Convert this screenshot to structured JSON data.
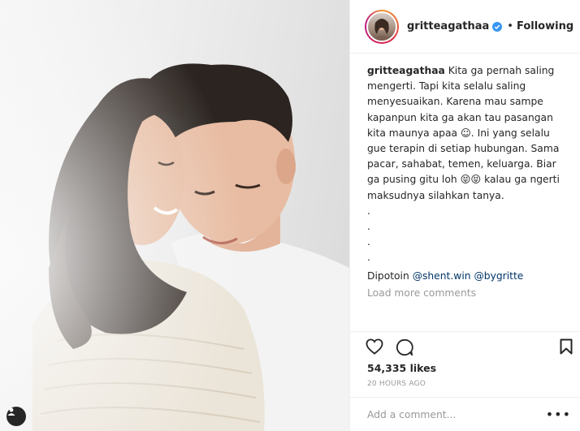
{
  "post": {
    "username": "gritteagathaa",
    "follow_status": "Following",
    "separator": "•",
    "caption_user": "gritteagathaa",
    "caption": " Kita ga pernah saling mengerti. Tapi kita selalu saling menyesuaikan. Karena mau sampe kapanpun kita ga akan tau pasangan kita maunya apaa ☺. Ini yang selalu gue terapin di setiap hubungan. Sama pacar, sahabat, temen, keluarga. Biar ga pusing gitu loh 😝😝 kalau ga ngerti maksudnya silahkan tanya.\n.\n.\n.\n.",
    "credit_prefix": "Dipotoin ",
    "mention_1": "@shent.win",
    "mention_2": "@bygritte",
    "load_more": "Load more comments",
    "likes": "54,335 likes",
    "time": "20 HOURS AGO",
    "comment_placeholder": "Add a comment...",
    "more_options": "•••"
  },
  "icons": {
    "like": "heart-icon",
    "comment": "speech-bubble-icon",
    "save": "bookmark-icon",
    "verified": "verified-badge-icon",
    "tag": "user-tag-icon"
  },
  "colors": {
    "verified": "#3897f0",
    "mention": "#003569",
    "muted": "#999999",
    "text": "#262626"
  }
}
